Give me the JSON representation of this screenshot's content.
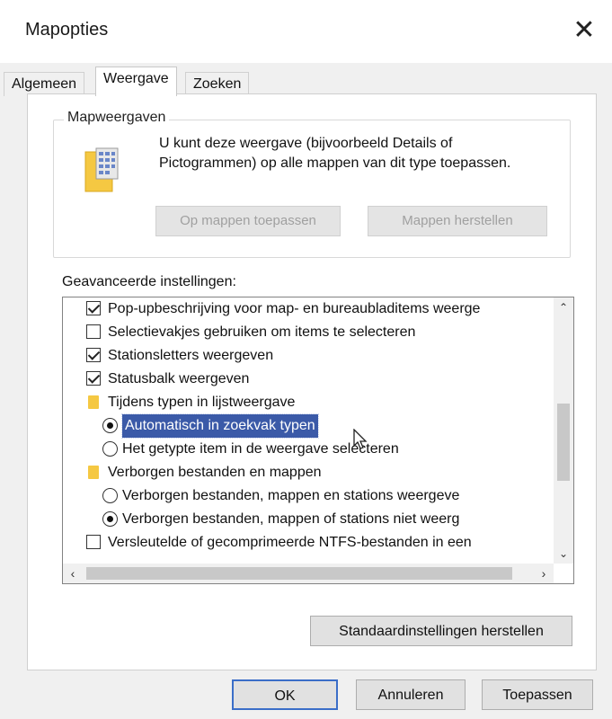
{
  "window": {
    "title": "Mapopties",
    "close_symbol": "✕"
  },
  "tabs": [
    {
      "label": "Algemeen"
    },
    {
      "label": "Weergave",
      "active": true
    },
    {
      "label": "Zoeken"
    }
  ],
  "folder_views": {
    "group_label": "Mapweergaven",
    "description": "U kunt deze weergave (bijvoorbeeld Details of Pictogrammen) op alle mappen van dit type toepassen.",
    "apply_button": "Op mappen toepassen",
    "reset_button": "Mappen herstellen"
  },
  "advanced": {
    "label": "Geavanceerde instellingen:",
    "items": [
      {
        "type": "checkbox",
        "checked": true,
        "indent": 1,
        "label": "Pop-upbeschrijving voor map- en bureaubladitems weerge"
      },
      {
        "type": "checkbox",
        "checked": false,
        "indent": 1,
        "label": "Selectievakjes gebruiken om items te selecteren"
      },
      {
        "type": "checkbox",
        "checked": true,
        "indent": 1,
        "label": "Stationsletters weergeven"
      },
      {
        "type": "checkbox",
        "checked": true,
        "indent": 1,
        "label": "Statusbalk weergeven"
      },
      {
        "type": "folder",
        "indent": 1,
        "label": "Tijdens typen in lijstweergave"
      },
      {
        "type": "radio",
        "checked": true,
        "indent": 2,
        "selected": true,
        "label": "Automatisch in zoekvak typen"
      },
      {
        "type": "radio",
        "checked": false,
        "indent": 2,
        "label": "Het getypte item in de weergave selecteren"
      },
      {
        "type": "folder",
        "indent": 1,
        "label": "Verborgen bestanden en mappen"
      },
      {
        "type": "radio",
        "checked": false,
        "indent": 2,
        "label": "Verborgen bestanden, mappen en stations weergeve"
      },
      {
        "type": "radio",
        "checked": true,
        "indent": 2,
        "label": "Verborgen bestanden, mappen of stations niet weerg"
      },
      {
        "type": "checkbox",
        "checked": false,
        "indent": 1,
        "label": "Versleutelde of gecomprimeerde NTFS-bestanden in een"
      }
    ],
    "restore_defaults_button": "Standaardinstellingen herstellen"
  },
  "footer": {
    "ok": "OK",
    "cancel": "Annuleren",
    "apply": "Toepassen"
  },
  "colors": {
    "selection": "#3b5aa8",
    "folder": "#f5c842",
    "primary_border": "#3b6ec8"
  }
}
